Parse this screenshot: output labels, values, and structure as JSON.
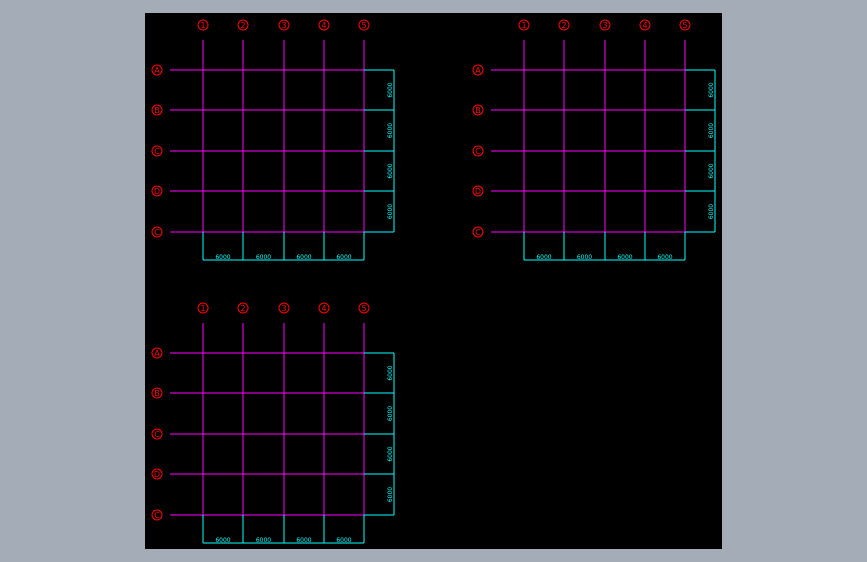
{
  "colors": {
    "background": "#a3acb7",
    "canvas": "#000000",
    "axis_bubble": "#ff0000",
    "grid": "#ff00ff",
    "dimension": "#00ffff"
  },
  "plans": [
    {
      "columns": [
        "1",
        "2",
        "3",
        "4",
        "5"
      ],
      "rows": [
        "A",
        "B",
        "C",
        "D",
        "C"
      ],
      "bay_dims": [
        "6000",
        "6000",
        "6000",
        "6000"
      ],
      "span_dims": [
        "6000",
        "6000",
        "6000",
        "6000"
      ]
    },
    {
      "columns": [
        "1",
        "2",
        "3",
        "4",
        "5"
      ],
      "rows": [
        "A",
        "B",
        "C",
        "D",
        "C"
      ],
      "bay_dims": [
        "6000",
        "6000",
        "6000",
        "6000"
      ],
      "span_dims": [
        "6000",
        "6000",
        "6000",
        "6000"
      ]
    },
    {
      "columns": [
        "1",
        "2",
        "3",
        "4",
        "5"
      ],
      "rows": [
        "A",
        "B",
        "C",
        "D",
        "C"
      ],
      "bay_dims": [
        "6000",
        "6000",
        "6000",
        "6000"
      ],
      "span_dims": [
        "6000",
        "6000",
        "6000",
        "6000"
      ]
    }
  ]
}
